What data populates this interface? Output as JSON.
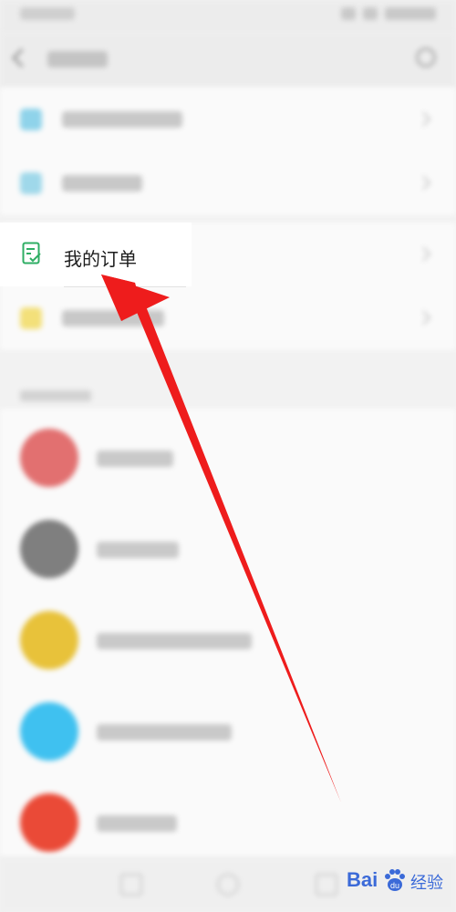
{
  "order": {
    "label": "我的订单"
  },
  "watermark": {
    "text": "Bai",
    "suffix": "经验",
    "color": "#3b6ad8"
  },
  "colors": {
    "order_icon": "#2fae64",
    "arrow": "#ee1c1c",
    "avatar_1": "#e27070",
    "avatar_2": "#7f7f7f",
    "avatar_3": "#e8c23a",
    "avatar_4": "#3fc1f0",
    "avatar_5": "#ea4a37"
  },
  "icons": [
    "back-arrow-icon",
    "search-icon",
    "order-list-icon",
    "chevron-right-icon",
    "baidu-paw-icon"
  ]
}
